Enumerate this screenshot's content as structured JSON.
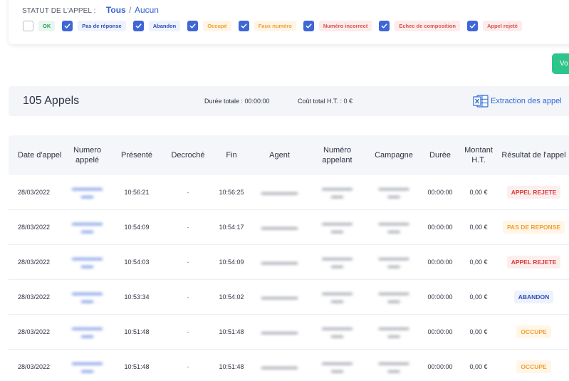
{
  "filter": {
    "label": "STATUT DE L'APPEL :",
    "all_link": "Tous",
    "separator": "/",
    "none_link": "Aucun",
    "statuses": [
      {
        "label": "OK",
        "checked": false,
        "tone": "ok"
      },
      {
        "label": "Pas de réponse",
        "checked": true,
        "tone": "blue"
      },
      {
        "label": "Abandon",
        "checked": true,
        "tone": "blue"
      },
      {
        "label": "Occupé",
        "checked": true,
        "tone": "orange"
      },
      {
        "label": "Faux numéro",
        "checked": true,
        "tone": "orange"
      },
      {
        "label": "Numéro incorrect",
        "checked": true,
        "tone": "red"
      },
      {
        "label": "Echec de composition",
        "checked": true,
        "tone": "red"
      },
      {
        "label": "Appel rejeté",
        "checked": true,
        "tone": "red"
      }
    ]
  },
  "view_button": "Vo",
  "summary": {
    "count": "105 Appels",
    "duration": "Durée totale : 00:00:00",
    "cost": "Coût total H.T. : 0 €",
    "export": "Extraction des appel"
  },
  "table": {
    "headers": {
      "date": "Date d'appel",
      "numero": "Numero appelé",
      "presente": "Présenté",
      "decroche": "Decroché",
      "fin": "Fin",
      "agent": "Agent",
      "appelant": "Numéro appelant",
      "campagne": "Campagne",
      "duree": "Durée",
      "montant": "Montant H.T.",
      "resultat": "Résultat de l'appel"
    },
    "rows": [
      {
        "date": "28/03/2022",
        "presente": "10:56:21",
        "decroche": "-",
        "fin": "10:56:25",
        "duree": "00:00:00",
        "montant": "0,00 €",
        "resultat": "APPEL REJETE",
        "res_type": "rejete"
      },
      {
        "date": "28/03/2022",
        "presente": "10:54:09",
        "decroche": "-",
        "fin": "10:54:17",
        "duree": "00:00:00",
        "montant": "0,00 €",
        "resultat": "PAS DE REPONSE",
        "res_type": "reponse"
      },
      {
        "date": "28/03/2022",
        "presente": "10:54:03",
        "decroche": "-",
        "fin": "10:54:09",
        "duree": "00:00:00",
        "montant": "0,00 €",
        "resultat": "APPEL REJETE",
        "res_type": "rejete"
      },
      {
        "date": "28/03/2022",
        "presente": "10:53:34",
        "decroche": "-",
        "fin": "10:54:02",
        "duree": "00:00:00",
        "montant": "0,00 €",
        "resultat": "ABANDON",
        "res_type": "abandon"
      },
      {
        "date": "28/03/2022",
        "presente": "10:51:48",
        "decroche": "-",
        "fin": "10:51:48",
        "duree": "00:00:00",
        "montant": "0,00 €",
        "resultat": "OCCUPE",
        "res_type": "occupe"
      },
      {
        "date": "28/03/2022",
        "presente": "10:51:48",
        "decroche": "-",
        "fin": "10:51:48",
        "duree": "00:00:00",
        "montant": "0,00 €",
        "resultat": "OCCUPE",
        "res_type": "occupe"
      }
    ]
  }
}
